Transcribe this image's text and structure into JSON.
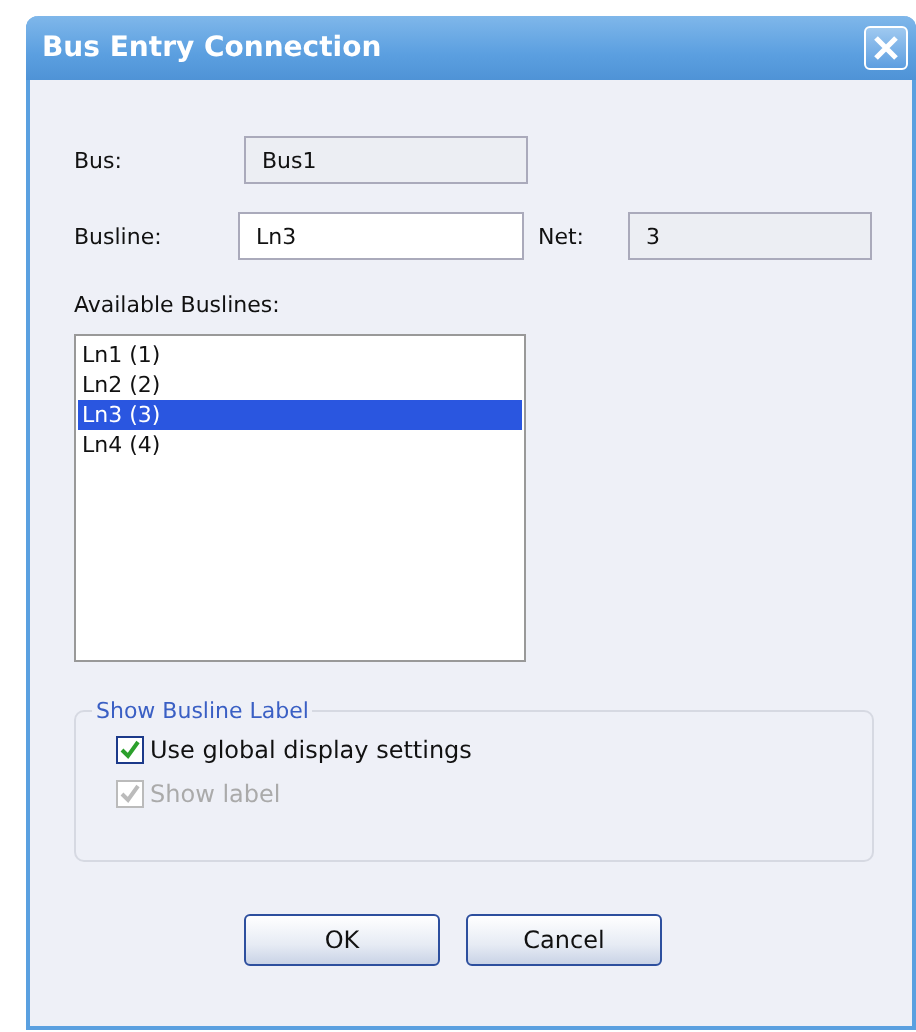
{
  "window": {
    "title": "Bus Entry Connection"
  },
  "fields": [
    {
      "label": "Bus:",
      "value": "Bus1",
      "readonly": true
    },
    {
      "label": "Busline:",
      "value": "Ln3",
      "readonly": false
    },
    {
      "label": "Net:",
      "value": "3",
      "readonly": true
    }
  ],
  "list": {
    "label": "Available Buslines:",
    "items": [
      {
        "text": "Ln1 (1)",
        "selected": false
      },
      {
        "text": "Ln2 (2)",
        "selected": false
      },
      {
        "text": "Ln3 (3)",
        "selected": true
      },
      {
        "text": "Ln4 (4)",
        "selected": false
      }
    ]
  },
  "group": {
    "title": "Show Busline Label",
    "checkboxes": [
      {
        "label": "Use global display settings",
        "checked": true,
        "disabled": false
      },
      {
        "label": "Show label",
        "checked": true,
        "disabled": true
      }
    ]
  },
  "buttons": [
    "OK",
    "Cancel"
  ]
}
